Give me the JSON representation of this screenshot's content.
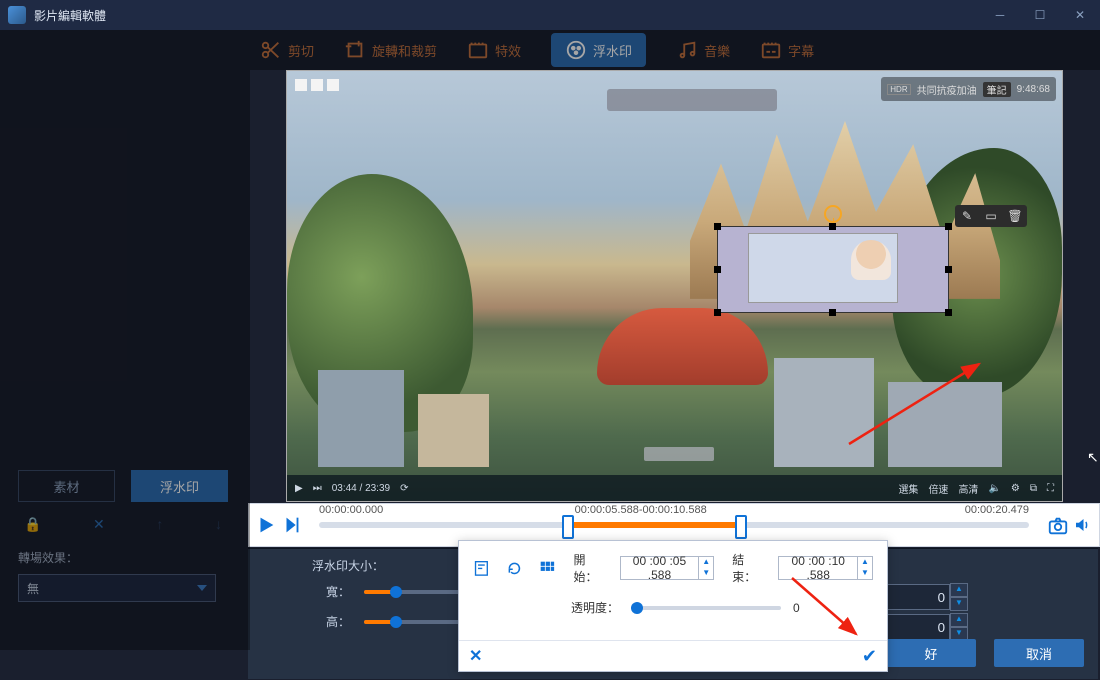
{
  "titlebar": {
    "app_name": "影片編輯軟體"
  },
  "tabs": [
    {
      "label": "剪切"
    },
    {
      "label": "旋轉和裁剪"
    },
    {
      "label": "特效"
    },
    {
      "label": "浮水印"
    },
    {
      "label": "音樂"
    },
    {
      "label": "字幕"
    }
  ],
  "preview": {
    "play_time": "03:44 / 23:39",
    "top_right_status": "共同抗疫加油",
    "top_right_badge": "筆記",
    "duration_badge": "9:48:68"
  },
  "wm_tools": {
    "edit": "✎",
    "image": "▭",
    "delete": "🗑"
  },
  "timeline": {
    "start": "00:00:00.000",
    "range": "00:00:05.588-00:00:10.588",
    "end": "00:00:20.479"
  },
  "left": {
    "tab_material": "素材",
    "tab_watermark": "浮水印",
    "transition_label": "轉場效果：",
    "transition_value": "無"
  },
  "lower": {
    "title": "浮水印大小：",
    "width_label": "寬：",
    "height_label": "高：",
    "width_value": "0",
    "height_value": "0",
    "ok": "好",
    "cancel": "取消"
  },
  "dialog": {
    "start_label": "開始：",
    "end_label": "結束：",
    "start_value": "00 :00 :05 .588",
    "end_value": "00 :00 :10 .588",
    "opacity_label": "透明度：",
    "opacity_value": "0"
  }
}
